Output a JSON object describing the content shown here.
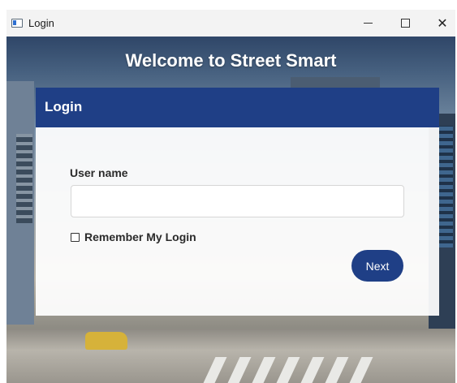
{
  "window": {
    "title": "Login",
    "icon": "app-window-icon",
    "controls": {
      "minimize_icon": "minimize-icon",
      "maximize_icon": "maximize-icon",
      "close_glyph": "✕"
    }
  },
  "banner": {
    "heading": "Welcome to Street Smart"
  },
  "login_panel": {
    "title": "Login",
    "username_label": "User name",
    "username_value": "",
    "username_placeholder": "",
    "remember_label": "Remember My Login",
    "remember_checked": false,
    "next_label": "Next"
  },
  "colors": {
    "accent": "#1f3f86",
    "title_text": "#ffffff"
  }
}
